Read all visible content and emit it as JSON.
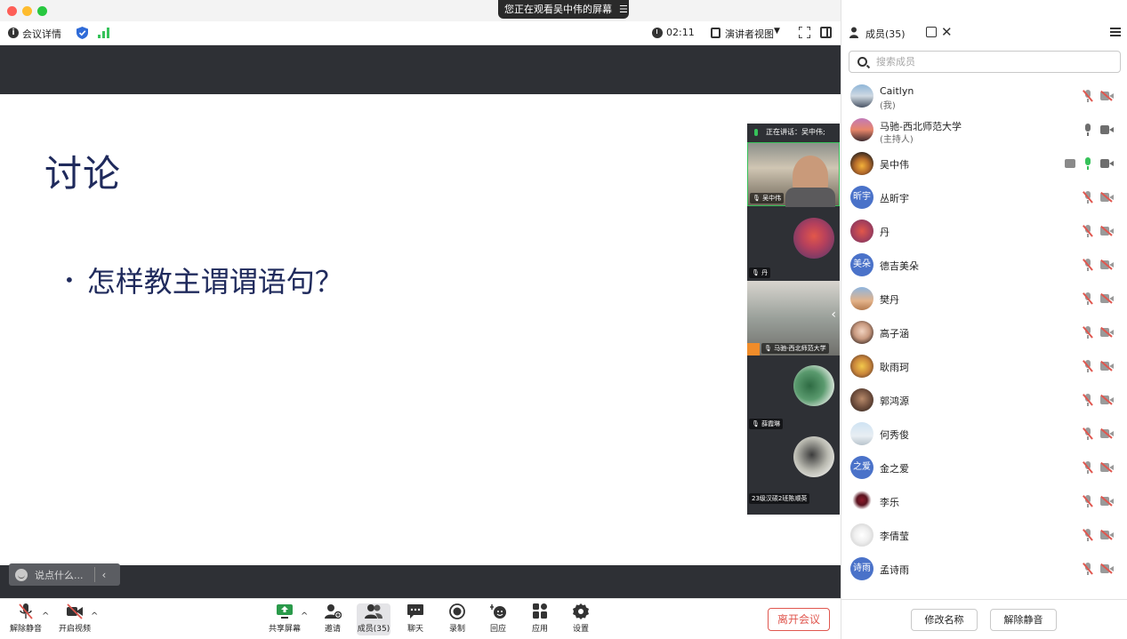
{
  "window": {
    "viewing_badge": "您正在观看吴中伟的屏幕",
    "viewing_badge_icon": "list-icon"
  },
  "meeting_bar": {
    "details_label": "会议详情",
    "timer": "02:11",
    "view_label": "演讲者视图",
    "icons": [
      "info-icon",
      "shield-icon",
      "signal-icon",
      "clock-icon",
      "speaker-view-icon",
      "fullscreen-icon",
      "sidebar-toggle-icon"
    ]
  },
  "slide": {
    "title": "讨论",
    "bullet": "怎样教主谓谓语句？"
  },
  "chat_quick": {
    "placeholder": "说点什么..."
  },
  "video_strip": {
    "speaking_label": "正在讲话：吴中伟;",
    "tiles": [
      {
        "label": "吴中伟",
        "mic": "active"
      },
      {
        "label": "丹",
        "mic": "muted"
      },
      {
        "label": "马驰-西北师范大学",
        "mic": "on"
      },
      {
        "label": "薛霞琳",
        "mic": "muted"
      },
      {
        "label": "23级汉硕2班陈顺英",
        "mic": "none"
      }
    ]
  },
  "controls": {
    "items": [
      {
        "key": "unmute",
        "label": "解除静音",
        "icon": "mic-muted-icon"
      },
      {
        "key": "video",
        "label": "开启视频",
        "icon": "camera-off-icon"
      },
      {
        "key": "share",
        "label": "共享屏幕",
        "icon": "share-screen-icon"
      },
      {
        "key": "invite",
        "label": "邀请",
        "icon": "invite-icon"
      },
      {
        "key": "members",
        "label": "成员(35)",
        "icon": "members-icon"
      },
      {
        "key": "chat",
        "label": "聊天",
        "icon": "chat-icon"
      },
      {
        "key": "record",
        "label": "录制",
        "icon": "record-icon"
      },
      {
        "key": "react",
        "label": "回应",
        "icon": "reaction-icon"
      },
      {
        "key": "apps",
        "label": "应用",
        "icon": "apps-icon"
      },
      {
        "key": "settings",
        "label": "设置",
        "icon": "gear-icon"
      }
    ],
    "leave_label": "离开会议"
  },
  "panel": {
    "title": "成员(35)",
    "search_placeholder": "搜索成员",
    "members": [
      {
        "name": "Caitlyn",
        "sub": "(我)",
        "avatar": "photo",
        "mic": "muted",
        "cam": "off"
      },
      {
        "name": "马驰-西北师范大学",
        "sub": "(主持人)",
        "avatar": "photo",
        "mic": "on",
        "cam": "on"
      },
      {
        "name": "吴中伟",
        "sub": "",
        "avatar": "photo",
        "mic": "active",
        "cam": "on",
        "sharing": true
      },
      {
        "name": "丛昕宇",
        "sub": "",
        "avatar": "initials",
        "initials": "昕宇",
        "mic": "muted",
        "cam": "off"
      },
      {
        "name": "丹",
        "sub": "",
        "avatar": "photo",
        "mic": "muted",
        "cam": "off"
      },
      {
        "name": "德吉美朵",
        "sub": "",
        "avatar": "initials",
        "initials": "美朵",
        "mic": "muted",
        "cam": "off"
      },
      {
        "name": "樊丹",
        "sub": "",
        "avatar": "photo",
        "mic": "muted",
        "cam": "off"
      },
      {
        "name": "高子涵",
        "sub": "",
        "avatar": "photo",
        "mic": "muted",
        "cam": "off"
      },
      {
        "name": "耿雨珂",
        "sub": "",
        "avatar": "photo",
        "mic": "muted",
        "cam": "off"
      },
      {
        "name": "郭鸿源",
        "sub": "",
        "avatar": "photo",
        "mic": "muted",
        "cam": "off"
      },
      {
        "name": "何秀俊",
        "sub": "",
        "avatar": "photo",
        "mic": "muted",
        "cam": "off"
      },
      {
        "name": "金之爱",
        "sub": "",
        "avatar": "initials",
        "initials": "之爱",
        "mic": "muted",
        "cam": "off"
      },
      {
        "name": "李乐",
        "sub": "",
        "avatar": "photo",
        "mic": "muted",
        "cam": "off"
      },
      {
        "name": "李倩莹",
        "sub": "",
        "avatar": "photo",
        "mic": "muted",
        "cam": "off"
      },
      {
        "name": "孟诗雨",
        "sub": "",
        "avatar": "initials",
        "initials": "诗雨",
        "mic": "muted",
        "cam": "off"
      }
    ],
    "rename_label": "修改名称",
    "unmute_label": "解除静音"
  },
  "colors": {
    "slide_text": "#1f2a5c",
    "leave_red": "#e0574f",
    "active_green": "#36c25a",
    "initials_blue": "#4a72c9",
    "stage_bg": "#2e3035"
  }
}
